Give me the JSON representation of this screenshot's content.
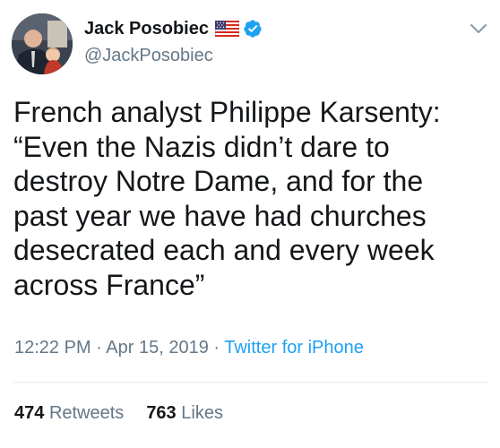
{
  "author": {
    "display_name": "Jack Posobiec",
    "handle": "@JackPosobiec",
    "flag_icon": "us-flag-icon",
    "verified_icon": "verified-badge-icon"
  },
  "tweet": {
    "lines": [
      "French analyst Philippe Karsenty:",
      "“Even the Nazis didn’t dare to",
      "destroy Notre Dame, and for the",
      "past year we have had churches",
      "desecrated each and every week",
      "across France”"
    ]
  },
  "meta": {
    "time": "12:22 PM",
    "sep1": " · ",
    "date": "Apr 15, 2019",
    "sep2": " · ",
    "source": "Twitter for iPhone"
  },
  "stats": {
    "retweets_count": "474",
    "retweets_label": "Retweets",
    "likes_count": "763",
    "likes_label": "Likes"
  },
  "colors": {
    "text": "#14171a",
    "secondary": "#657786",
    "link": "#1da1f2",
    "verified": "#1da1f2"
  }
}
